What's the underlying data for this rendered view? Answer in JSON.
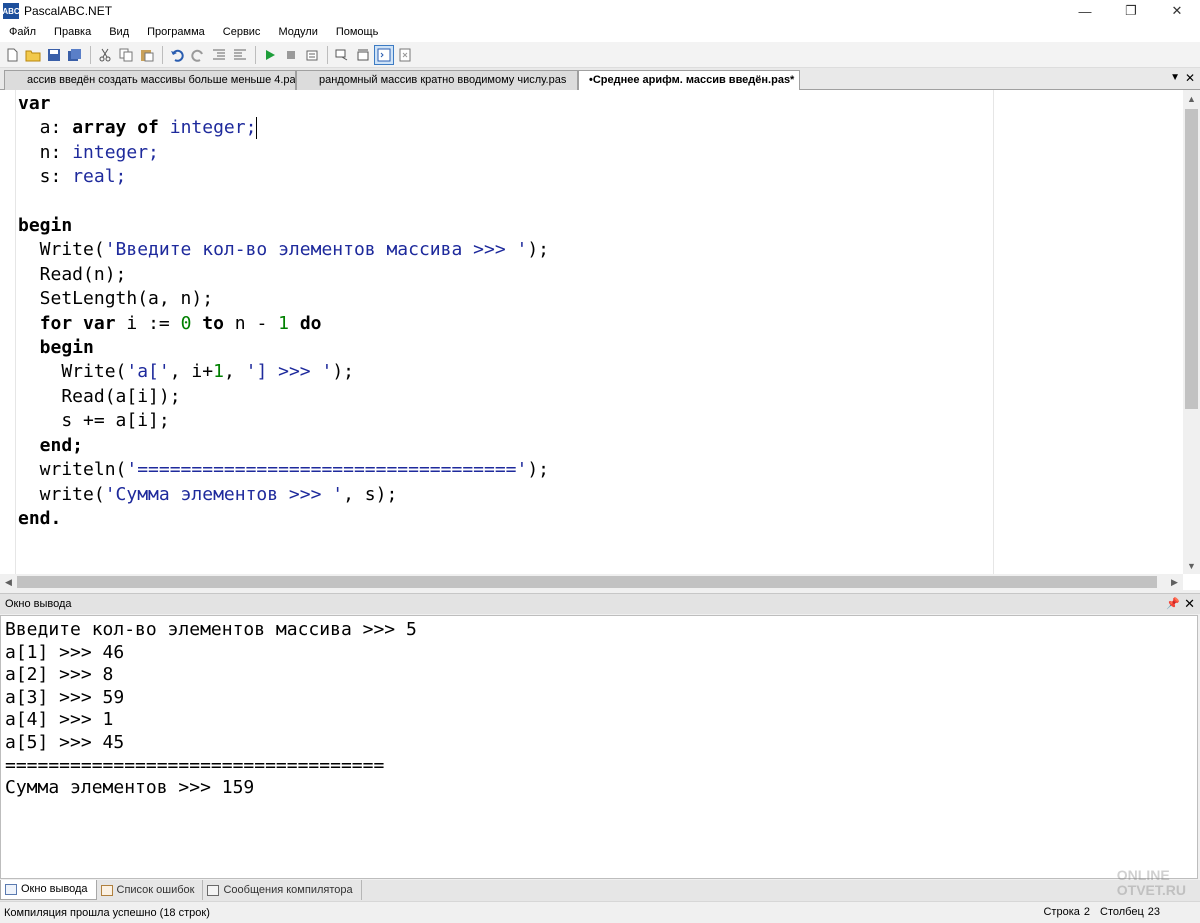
{
  "window": {
    "title": "PascalABC.NET",
    "icon_text": "ABC"
  },
  "menu": [
    "Файл",
    "Правка",
    "Вид",
    "Программа",
    "Сервис",
    "Модули",
    "Помощь"
  ],
  "tabs": [
    {
      "label": "ассив введён создать массивы больше меньше 4.pas",
      "active": false
    },
    {
      "label": "рандомный массив кратно вводимому числу.pas",
      "active": false
    },
    {
      "label": "•Среднее арифм. массив введён.pas*",
      "active": true
    }
  ],
  "code": {
    "l1": "var",
    "l2a": "  a: ",
    "l2b": "array",
    "l2c": " ",
    "l2d": "of",
    "l2e": " ",
    "l2f": "integer;",
    "l3a": "  n: ",
    "l3b": "integer;",
    "l4a": "  s: ",
    "l4b": "real;",
    "l6": "begin",
    "l7a": "  Write(",
    "l7b": "'Введите кол-во элементов массива >>> '",
    "l7c": ");",
    "l8": "  Read(n);",
    "l9": "  SetLength(a, n);",
    "l10a": "  ",
    "l10b": "for",
    "l10c": " ",
    "l10d": "var",
    "l10e": " i := ",
    "l10f": "0",
    "l10g": " ",
    "l10h": "to",
    "l10i": " n - ",
    "l10j": "1",
    "l10k": " ",
    "l10l": "do",
    "l11": "  begin",
    "l12a": "    Write(",
    "l12b": "'a['",
    "l12c": ", i+",
    "l12d": "1",
    "l12e": ", ",
    "l12f": "'] >>> '",
    "l12g": ");",
    "l13": "    Read(a[i]);",
    "l14": "    s += a[i];",
    "l15": "  end;",
    "l16a": "  writeln(",
    "l16b": "'==================================='",
    "l16c": ");",
    "l17a": "  write(",
    "l17b": "'Сумма элементов >>> '",
    "l17c": ", s);",
    "l18": "end."
  },
  "output_panel": {
    "title": "Окно вывода",
    "lines": [
      "Введите кол-во элементов массива >>> 5",
      "a[1] >>> 46",
      "a[2] >>> 8",
      "a[3] >>> 59",
      "a[4] >>> 1",
      "a[5] >>> 45",
      "===================================",
      "Сумма элементов >>> 159"
    ]
  },
  "bottom_tabs": [
    "Окно вывода",
    "Список ошибок",
    "Сообщения компилятора"
  ],
  "status": {
    "message": "Компиляция прошла успешно (18 строк)",
    "row_label": "Строка",
    "row_value": "2",
    "col_label": "Столбец",
    "col_value": "23"
  },
  "watermark": {
    "line1": "ONLINE",
    "line2": "OTVET.RU"
  }
}
